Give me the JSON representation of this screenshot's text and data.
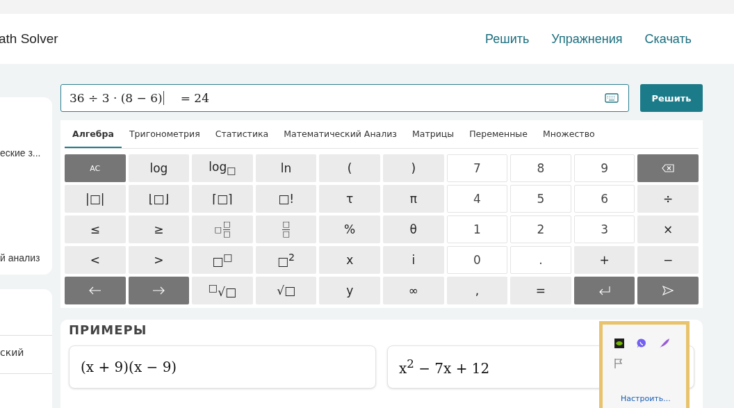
{
  "header": {
    "title": "ath Solver",
    "nav": [
      "Решить",
      "Упражнения",
      "Скачать"
    ]
  },
  "sidebar": {
    "items": [
      "еские з...",
      "й анализ"
    ],
    "items_2": [
      "ский"
    ]
  },
  "input": {
    "expression": "36 ÷ 3 · (8 − 6)",
    "result": "= 24"
  },
  "solve_button": "Решить",
  "tabs": [
    {
      "label": "Алгебра",
      "selected": true
    },
    {
      "label": "Тригонометрия",
      "selected": false
    },
    {
      "label": "Статистика",
      "selected": false
    },
    {
      "label": "Математический Анализ",
      "selected": false
    },
    {
      "label": "Матрицы",
      "selected": false
    },
    {
      "label": "Переменные",
      "selected": false
    },
    {
      "label": "Множество",
      "selected": false
    }
  ],
  "keys": [
    {
      "kind": "command",
      "label": "AC"
    },
    {
      "kind": "function",
      "label": "log"
    },
    {
      "kind": "function",
      "label": "log$_{□}$"
    },
    {
      "kind": "function",
      "label": "ln"
    },
    {
      "kind": "function",
      "label": "("
    },
    {
      "kind": "function",
      "label": ")"
    },
    {
      "kind": "digit",
      "label": "7"
    },
    {
      "kind": "digit",
      "label": "8"
    },
    {
      "kind": "digit",
      "label": "9"
    },
    {
      "kind": "backspace"
    },
    {
      "kind": "function",
      "label": "|□|"
    },
    {
      "kind": "function",
      "label": "⌊□⌋"
    },
    {
      "kind": "function",
      "label": "⌈□⌉"
    },
    {
      "kind": "function",
      "label": "□!"
    },
    {
      "kind": "function",
      "label": "τ"
    },
    {
      "kind": "function",
      "label": "π"
    },
    {
      "kind": "digit",
      "label": "4"
    },
    {
      "kind": "digit",
      "label": "5"
    },
    {
      "kind": "digit",
      "label": "6"
    },
    {
      "kind": "function",
      "label": "÷"
    },
    {
      "kind": "function",
      "label": "≤"
    },
    {
      "kind": "function",
      "label": "≥"
    },
    {
      "kind": "fraction",
      "whole": "□",
      "num": "□",
      "den": "□"
    },
    {
      "kind": "fraction",
      "num": "□",
      "den": "□"
    },
    {
      "kind": "function",
      "label": "%"
    },
    {
      "kind": "function",
      "label": "θ"
    },
    {
      "kind": "digit",
      "label": "1"
    },
    {
      "kind": "digit",
      "label": "2"
    },
    {
      "kind": "digit",
      "label": "3"
    },
    {
      "kind": "function",
      "label": "×"
    },
    {
      "kind": "function",
      "label": "<"
    },
    {
      "kind": "function",
      "label": ">"
    },
    {
      "kind": "function",
      "label": "□$^{□}$"
    },
    {
      "kind": "function",
      "label": "□$^{2}$"
    },
    {
      "kind": "function",
      "label": "x"
    },
    {
      "kind": "function",
      "label": "i"
    },
    {
      "kind": "digit",
      "label": "0"
    },
    {
      "kind": "digit",
      "label": "."
    },
    {
      "kind": "function",
      "label": "+"
    },
    {
      "kind": "function",
      "label": "−"
    },
    {
      "kind": "left"
    },
    {
      "kind": "right"
    },
    {
      "kind": "function",
      "label": "$^{□}$√□"
    },
    {
      "kind": "function",
      "label": "√□"
    },
    {
      "kind": "function",
      "label": "y"
    },
    {
      "kind": "function",
      "label": "∞"
    },
    {
      "kind": "function",
      "label": ","
    },
    {
      "kind": "function",
      "label": "="
    },
    {
      "kind": "enter"
    },
    {
      "kind": "send"
    }
  ],
  "examples": {
    "title": "ПРИМЕРЫ",
    "items": [
      "(x + 9)(x − 9)",
      "x$^{2}$ − 7x + 12"
    ]
  },
  "tray": {
    "link": "Настроить..."
  }
}
